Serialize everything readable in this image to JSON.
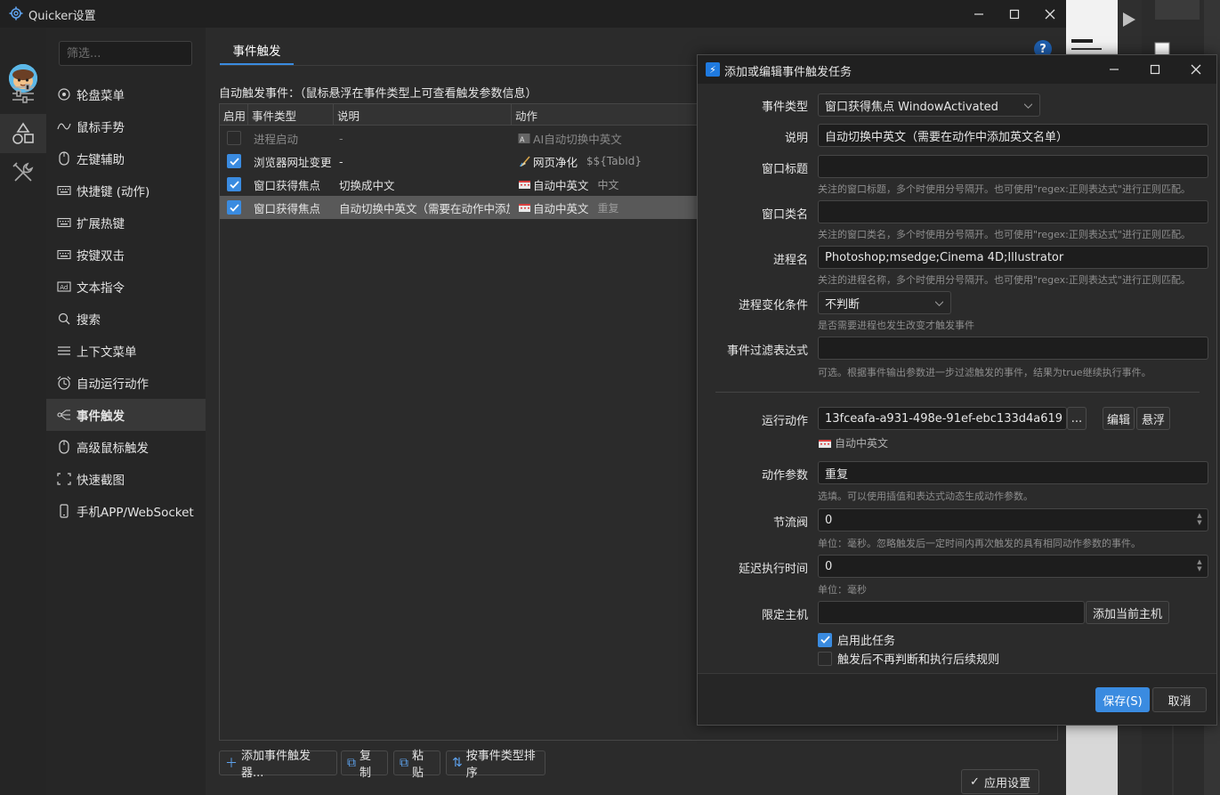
{
  "window": {
    "title": "Quicker设置"
  },
  "nav": {
    "filter_placeholder": "筛选...",
    "items": [
      {
        "label": "轮盘菜单",
        "icon": "wheel-icon"
      },
      {
        "label": "鼠标手势",
        "icon": "gesture-icon"
      },
      {
        "label": "左键辅助",
        "icon": "mouse-icon"
      },
      {
        "label": "快捷键 (动作)",
        "icon": "keyboard-icon"
      },
      {
        "label": "扩展热键",
        "icon": "keyboard-icon"
      },
      {
        "label": "按键双击",
        "icon": "keyboard-icon"
      },
      {
        "label": "文本指令",
        "icon": "ad-icon"
      },
      {
        "label": "搜索",
        "icon": "search-icon"
      },
      {
        "label": "上下文菜单",
        "icon": "menu-icon"
      },
      {
        "label": "自动运行动作",
        "icon": "alarm-icon"
      },
      {
        "label": "事件触发",
        "icon": "event-icon",
        "active": true
      },
      {
        "label": "高级鼠标触发",
        "icon": "mouse-icon"
      },
      {
        "label": "快速截图",
        "icon": "screenshot-icon"
      },
      {
        "label": "手机APP/WebSocket",
        "icon": "phone-icon"
      }
    ]
  },
  "content": {
    "tab": "事件触发",
    "help": "?",
    "section_label": "自动触发事件：（鼠标悬浮在事件类型上可查看触发参数信息）",
    "columns": [
      "启用",
      "事件类型",
      "说明",
      "动作"
    ],
    "rows": [
      {
        "enabled": false,
        "type": "进程启动",
        "desc": "-",
        "action": "AI自动切换中英文",
        "param": "",
        "dimmed": true
      },
      {
        "enabled": true,
        "type": "浏览器网址变更",
        "desc": "-",
        "action": "网页净化",
        "param": "$${TabId}",
        "dimmed": false
      },
      {
        "enabled": true,
        "type": "窗口获得焦点",
        "desc": "切换成中文",
        "action": "自动中英文",
        "param": "中文",
        "dimmed": false
      },
      {
        "enabled": true,
        "type": "窗口获得焦点",
        "desc": "自动切换中英文（需要在动作中添加",
        "action": "自动中英文",
        "param": "重复",
        "dimmed": false,
        "selected": true
      }
    ],
    "buttons": {
      "add": "添加事件触发器...",
      "copy": "复制",
      "paste": "粘贴",
      "sort": "按事件类型排序"
    },
    "apply": "应用设置"
  },
  "dialog": {
    "title": "添加或编辑事件触发任务",
    "event_type_label": "事件类型",
    "event_type_value": "窗口获得焦点 WindowActivated",
    "desc_label": "说明",
    "desc_value": "自动切换中英文（需要在动作中添加英文名单）",
    "win_title_label": "窗口标题",
    "win_title_value": "",
    "win_title_hint": "关注的窗口标题，多个时使用分号隔开。也可使用\"regex:正则表达式\"进行正则匹配。",
    "win_class_label": "窗口类名",
    "win_class_value": "",
    "win_class_hint": "关注的窗口类名，多个时使用分号隔开。也可使用\"regex:正则表达式\"进行正则匹配。",
    "process_label": "进程名",
    "process_value": "Photoshop;msedge;Cinema 4D;Illustrator",
    "process_hint": "关注的进程名称，多个时使用分号隔开。也可使用\"regex:正则表达式\"进行正则匹配。",
    "proc_change_label": "进程变化条件",
    "proc_change_value": "不判断",
    "proc_change_hint": "是否需要进程也发生改变才触发事件",
    "filter_label": "事件过滤表达式",
    "filter_value": "",
    "filter_hint": "可选。根据事件输出参数进一步过滤触发的事件，结果为true继续执行事件。",
    "run_action_label": "运行动作",
    "run_action_value": "13fceafa-a931-498e-91ef-ebc133d4a619",
    "browse_btn": "...",
    "edit_btn": "编辑",
    "float_btn": "悬浮",
    "run_action_name": "自动中英文",
    "action_param_label": "动作参数",
    "action_param_value": "重复",
    "action_param_hint": "选填。可以使用插值和表达式动态生成动作参数。",
    "throttle_label": "节流阀",
    "throttle_value": "0",
    "throttle_hint": "单位：毫秒。忽略触发后一定时间内再次触发的具有相同动作参数的事件。",
    "delay_label": "延迟执行时间",
    "delay_value": "0",
    "delay_hint": "单位：毫秒",
    "host_label": "限定主机",
    "host_value": "",
    "add_host_btn": "添加当前主机",
    "enable_task": "启用此任务",
    "enable_task_checked": true,
    "stop_after": "触发后不再判断和执行后续规则",
    "stop_after_checked": false,
    "save": "保存(S)",
    "cancel": "取消"
  },
  "colors": {
    "accent": "#3a8be0",
    "selection": "#595959",
    "background": "#2b2b2b"
  }
}
